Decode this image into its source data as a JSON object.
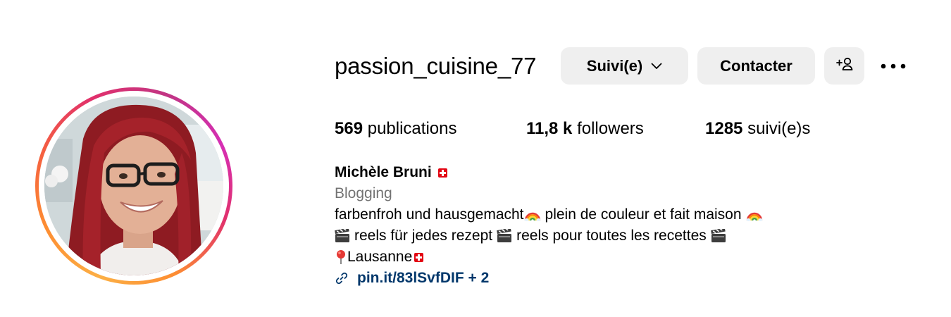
{
  "profile": {
    "username": "passion_cuisine_77",
    "follow_button": "Suivi(e)",
    "contact_button": "Contacter",
    "stats": {
      "posts_count": "569",
      "posts_label": "publications",
      "followers_count": "11,8 k",
      "followers_label": "followers",
      "following_count": "1285",
      "following_label": "suivi(e)s"
    },
    "bio": {
      "name": "Michèle Bruni",
      "category": "Blogging",
      "line1_a": "farbenfroh und hausgemacht",
      "line1_b": "plein de couleur et fait maison",
      "line2_a": "reels für jedes rezept",
      "line2_b": "reels pour toutes les recettes",
      "location": "Lausanne",
      "link": "pin.it/83lSvfDIF + 2"
    }
  },
  "icons": {
    "follow_chevron": "chevron-down-icon",
    "suggest": "add-person-icon",
    "more": "more-horizontal-icon",
    "rainbow": "rainbow-emoji",
    "clapper": "clapper-board-emoji",
    "pin": "round-pushpin-emoji",
    "flag": "swiss-flag-emoji",
    "link": "link-icon"
  },
  "colors": {
    "button_bg": "#efefef",
    "category_gray": "#737373",
    "link_blue": "#00376b",
    "ring_gradient": [
      "#fcaf45",
      "#f56040",
      "#e1306c",
      "#c13584"
    ]
  }
}
